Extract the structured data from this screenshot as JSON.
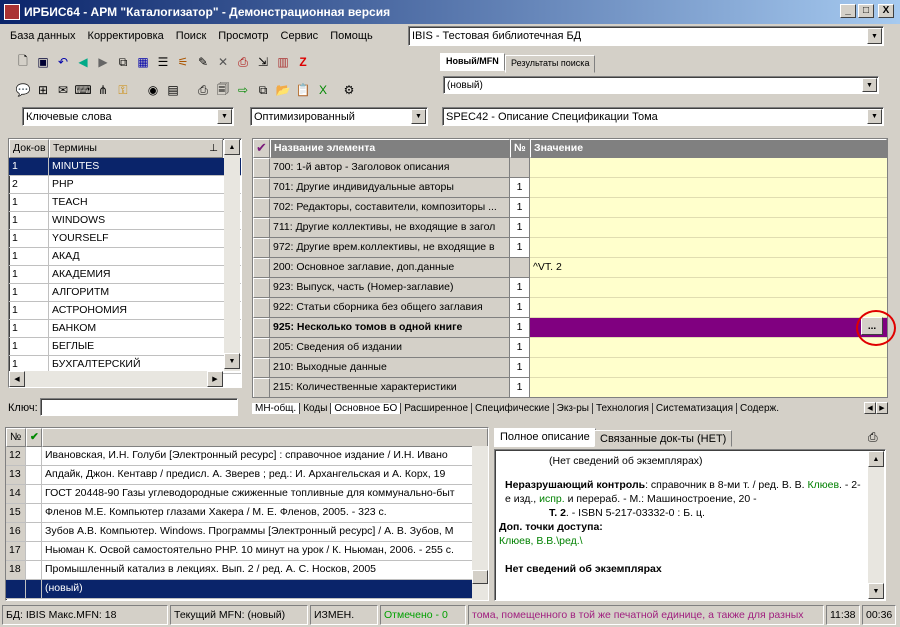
{
  "window": {
    "title": "ИРБИС64 - АРМ \"Каталогизатор\" - Демонстрационная версия",
    "min": "_",
    "max": "□",
    "close": "X"
  },
  "menu": [
    "База данных",
    "Корректировка",
    "Поиск",
    "Просмотр",
    "Сервис",
    "Помощь"
  ],
  "db_select": "IBIS - Тестовая библиотечная БД",
  "right_tabs": {
    "new": "Новый/MFN",
    "results": "Результаты поиска"
  },
  "new_select": "(новый)",
  "filters": {
    "dict": "Ключевые слова",
    "mode": "Оптимизированный",
    "worksheet": "SPEC42 - Описание Спецификации Тома"
  },
  "dictionary": {
    "col_docs": "Док-ов",
    "col_terms": "Термины",
    "rows": [
      [
        "1",
        "MINUTES"
      ],
      [
        "2",
        "PHP"
      ],
      [
        "1",
        "TEACH"
      ],
      [
        "1",
        "WINDOWS"
      ],
      [
        "1",
        "YOURSELF"
      ],
      [
        "1",
        "АКАД"
      ],
      [
        "1",
        "АКАДЕМИЯ"
      ],
      [
        "1",
        "АЛГОРИТМ"
      ],
      [
        "1",
        "АСТРОНОМИЯ"
      ],
      [
        "1",
        "БАНКОМ"
      ],
      [
        "1",
        "БЕГЛЫЕ"
      ],
      [
        "1",
        "БУХГАЛТЕРСКИЙ"
      ]
    ],
    "key_label": "Ключ:",
    "key_value": ""
  },
  "worksheet_grid": {
    "col_check": "✔",
    "col_name": "Название элемента",
    "col_num": "№",
    "col_value": "Значение",
    "rows": [
      {
        "name": "700: 1-й автор - Заголовок описания",
        "num": "",
        "value": ""
      },
      {
        "name": "701: Другие индивидуальные авторы",
        "num": "1",
        "value": ""
      },
      {
        "name": "702: Редакторы, составители, композиторы ...",
        "num": "1",
        "value": ""
      },
      {
        "name": "711: Другие коллективы, не входящие в загол",
        "num": "1",
        "value": ""
      },
      {
        "name": "972: Другие врем.коллективы, не входящие в",
        "num": "1",
        "value": ""
      },
      {
        "name": "200: Основное заглавие, доп.данные",
        "num": "",
        "value": "^VT. 2"
      },
      {
        "name": "923: Выпуск, часть (Номер-заглавие)",
        "num": "1",
        "value": ""
      },
      {
        "name": "922: Статьи сборника без общего заглавия",
        "num": "1",
        "value": ""
      },
      {
        "name": "925: Несколько томов в одной книге",
        "num": "1",
        "value": "",
        "selected": true
      },
      {
        "name": "205: Сведения об издании",
        "num": "1",
        "value": ""
      },
      {
        "name": "210: Выходные данные",
        "num": "1",
        "value": ""
      },
      {
        "name": "215: Количественные характеристики",
        "num": "1",
        "value": ""
      }
    ],
    "ellipsis": "..."
  },
  "ws_tabs": [
    "МН-общ.",
    "Коды",
    "Основное БО",
    "Расширенное",
    "Специфические",
    "Экз-ры",
    "Технология",
    "Систематизация",
    "Содерж."
  ],
  "records": {
    "col_num": "№",
    "col_check": "✔",
    "rows": [
      [
        "12",
        "Ивановская, И.Н. Голуби [Электронный ресурс] : справочное издание / И.Н. Ивано"
      ],
      [
        "13",
        "Апдайк, Джон. Кентавр / предисл. А. Зверев ; ред.: И. Архангельская и А. Корх, 19"
      ],
      [
        "14",
        "ГОСТ 20448-90 Газы углеводородные сжиженные топливные для коммунально-быт"
      ],
      [
        "15",
        "Фленов М.Е. Компьютер глазами Хакера / М. Е. Фленов, 2005. - 323 с."
      ],
      [
        "16",
        "Зубов А.В. Компьютер. Windows. Программы [Электронный ресурс] / А. В. Зубов, М"
      ],
      [
        "17",
        "Ньюман К. Освой самостоятельно PHP. 10 минут на урок / К. Ньюман, 2006. - 255 с."
      ],
      [
        "18",
        "Промышленный катализ в лекциях. Вып. 2 / ред. А. С. Носков, 2005"
      ],
      [
        "",
        "(новый)"
      ]
    ]
  },
  "desc_tabs": {
    "full": "Полное описание",
    "linked": "Связанные док-ты (НЕТ)"
  },
  "description": {
    "line1": "(Нет сведений об экземплярах)",
    "p1_bold": "Неразрушающий контроль",
    "p1_a": ": справочник в 8-ми т. / ред. В. В. ",
    "p1_link": "Клюев",
    "p1_b": ". - 2-е изд., ",
    "p1_link2": "испр.",
    "p1_c": " и перераб. - М.: Машиностроение, 20 -",
    "p2_bold": "Т. 2",
    "p2_text": ". - ISBN 5-217-03332-0 : Б. ц.",
    "access_label": "Доп. точки доступа:",
    "access_value": "Клюев, В.В.\\ред.\\",
    "no_copies": "Нет сведений об экземплярах"
  },
  "status": {
    "db": "БД: IBIS Макс.MFN: 18",
    "current": "Текущий MFN: (новый)",
    "changed": "ИЗМЕН.",
    "marked": "Отмечено - 0",
    "hint": "тома, помещенного в той же печатной единице, а также для разных",
    "time1": "11:38",
    "time2": "00:36"
  },
  "colors": {
    "selected_row": "#800080",
    "grid_value_bg": "#ffffcc",
    "nav_selected": "#0a246a",
    "link_green": "#008000",
    "hint_purple": "#a0207f",
    "red_circle": "#e00000"
  }
}
